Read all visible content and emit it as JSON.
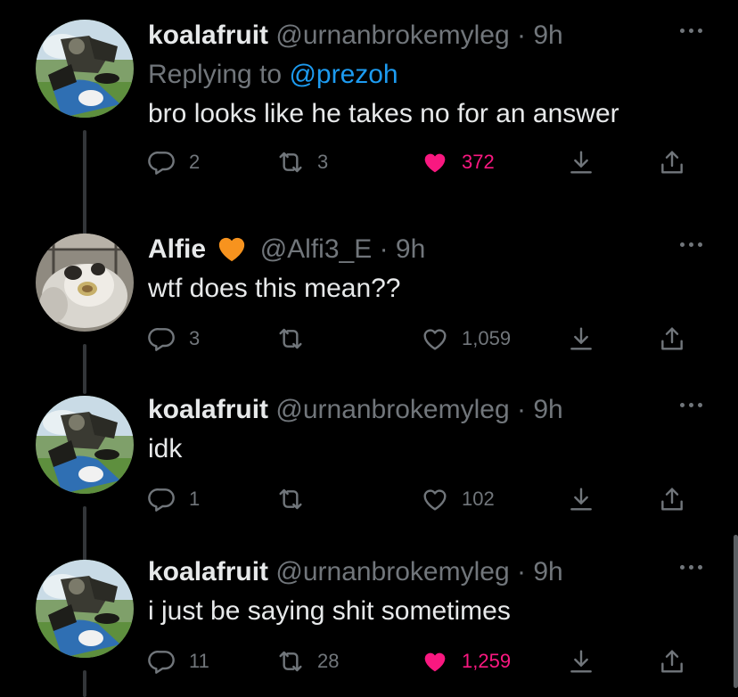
{
  "colors": {
    "background": "#000000",
    "text": "#e7e9ea",
    "muted": "#71767b",
    "link": "#1d9bf0",
    "like_active": "#f91880",
    "heart_emoji": "#f7931e"
  },
  "icons": {
    "reply": "speech-bubble-icon",
    "retweet": "retweet-arrows-icon",
    "like": "heart-icon",
    "save": "download-arrow-icon",
    "share": "share-upload-icon",
    "more": "more-dots-icon",
    "emoji": "orange-heart-emoji"
  },
  "tweets": [
    {
      "name": "koalafruit",
      "handle": "@urnanbrokemyleg",
      "dot": "·",
      "time": "9h",
      "reply_prefix": "Replying to",
      "reply_handle": "@prezoh",
      "text": "bro looks like he takes no for an answer",
      "replies": "2",
      "retweets": "3",
      "likes": "372",
      "liked": true
    },
    {
      "name": "Alfie",
      "handle": "@Alfi3_E",
      "dot": "·",
      "time": "9h",
      "text": "wtf does this mean??",
      "replies": "3",
      "retweets": "",
      "likes": "1,059",
      "liked": false
    },
    {
      "name": "koalafruit",
      "handle": "@urnanbrokemyleg",
      "dot": "·",
      "time": "9h",
      "text": "idk",
      "replies": "1",
      "retweets": "",
      "likes": "102",
      "liked": false
    },
    {
      "name": "koalafruit",
      "handle": "@urnanbrokemyleg",
      "dot": "·",
      "time": "9h",
      "text": "i just be saying shit sometimes",
      "replies": "11",
      "retweets": "28",
      "likes": "1,259",
      "liked": true
    }
  ]
}
